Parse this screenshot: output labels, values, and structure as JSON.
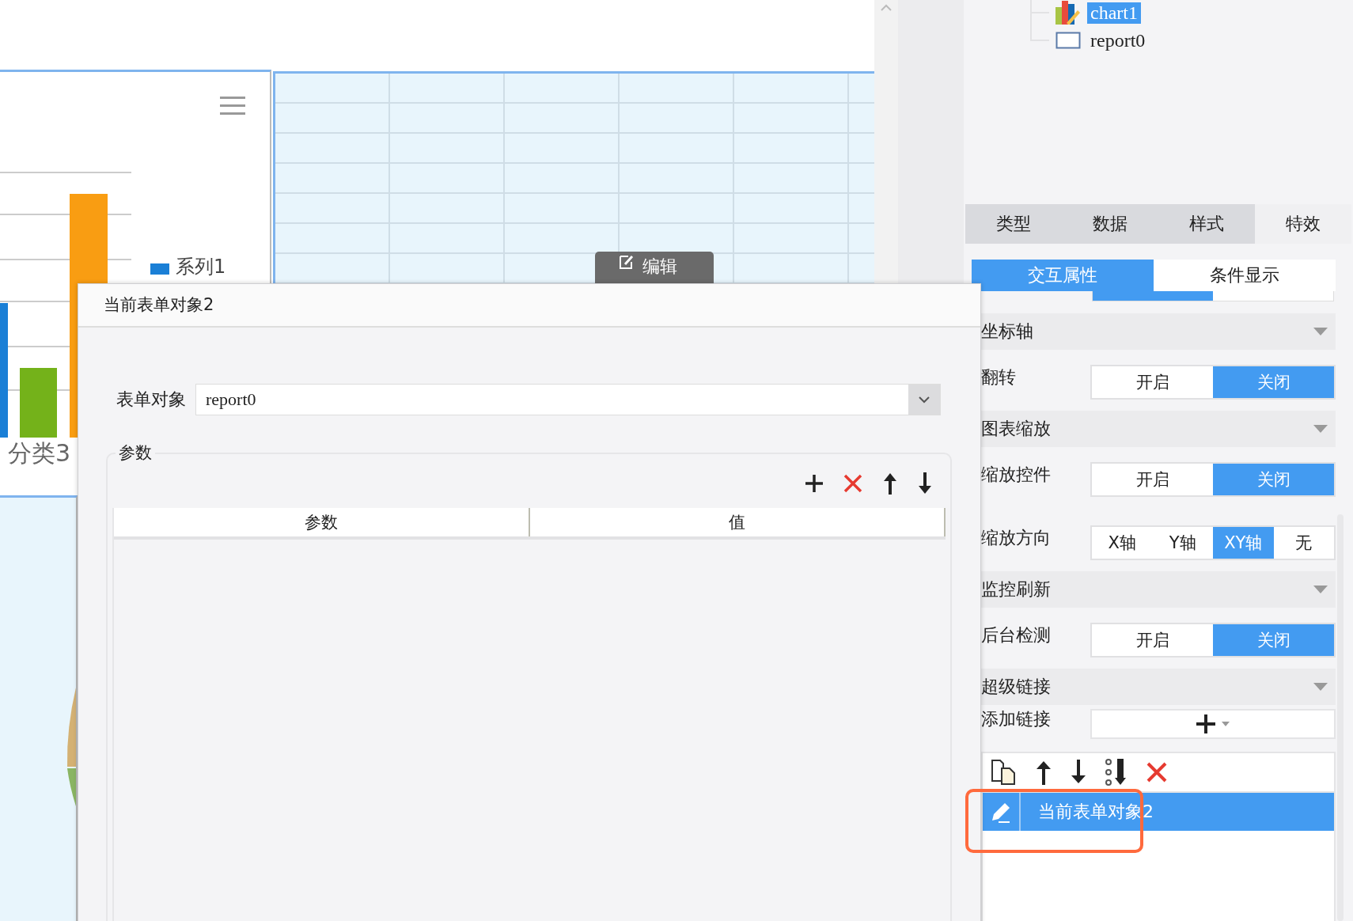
{
  "canvas": {
    "legend_label": "系列1",
    "category_label": "分类3",
    "edit_button": "编辑"
  },
  "tree": [
    {
      "label": "chart1",
      "kind": "chart",
      "selected": true
    },
    {
      "label": "report0",
      "kind": "report",
      "selected": false
    }
  ],
  "tabs": [
    {
      "label": "类型",
      "selected": false
    },
    {
      "label": "数据",
      "selected": false
    },
    {
      "label": "样式",
      "selected": false
    },
    {
      "label": "特效",
      "selected": true
    }
  ],
  "subtabs": [
    {
      "label": "交互属性",
      "selected": true
    },
    {
      "label": "条件显示",
      "selected": false
    }
  ],
  "sections": [
    {
      "kind": "header",
      "label": "坐标轴"
    },
    {
      "kind": "toggle",
      "label": "翻转",
      "options": [
        {
          "label": "开启",
          "selected": false
        },
        {
          "label": "关闭",
          "selected": true
        }
      ]
    },
    {
      "kind": "header",
      "label": "图表缩放"
    },
    {
      "kind": "toggle",
      "label": "缩放控件",
      "options": [
        {
          "label": "开启",
          "selected": false
        },
        {
          "label": "关闭",
          "selected": true
        }
      ]
    },
    {
      "kind": "toggle",
      "label": "缩放方向",
      "options": [
        {
          "label": "X轴",
          "selected": false
        },
        {
          "label": "Y轴",
          "selected": false
        },
        {
          "label": "XY轴",
          "selected": true
        },
        {
          "label": "无",
          "selected": false
        }
      ]
    },
    {
      "kind": "header",
      "label": "监控刷新"
    },
    {
      "kind": "toggle",
      "label": "后台检测",
      "options": [
        {
          "label": "开启",
          "selected": false
        },
        {
          "label": "关闭",
          "selected": true
        }
      ]
    },
    {
      "kind": "header",
      "label": "超级链接"
    },
    {
      "kind": "add_link",
      "label": "添加链接"
    }
  ],
  "links": [
    {
      "label": "当前表单对象2",
      "selected": true
    }
  ],
  "dialog": {
    "title": "当前表单对象2",
    "form_object_label": "表单对象",
    "form_object_value": "report0",
    "params_legend": "参数",
    "columns": [
      "参数",
      "值"
    ]
  }
}
